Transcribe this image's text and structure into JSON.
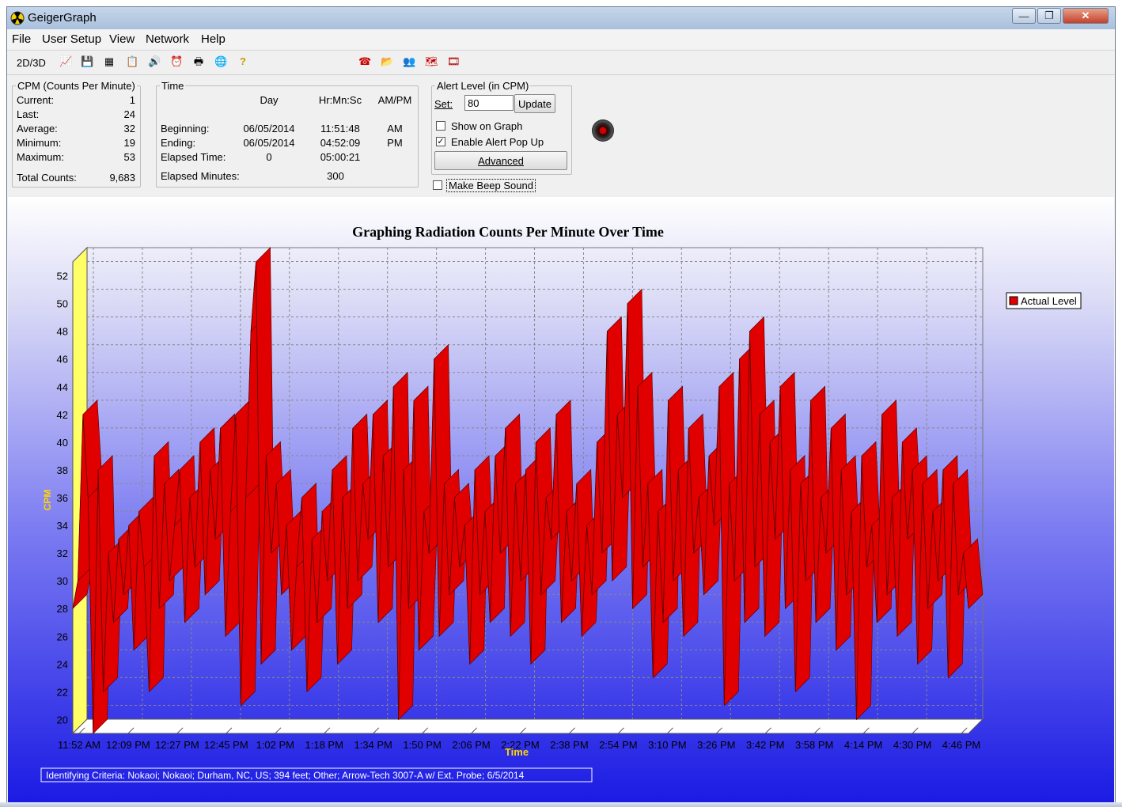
{
  "window": {
    "title": "GeigerGraph",
    "minimize": "—",
    "maximize": "❐",
    "close": "✕"
  },
  "menu": [
    "File",
    "User Setup",
    "View",
    "Network",
    "Help"
  ],
  "toolbar": {
    "mode_label": "2D/3D",
    "icons": [
      "graph-settings-icon",
      "save-icon",
      "table-icon",
      "report-icon",
      "alarm-icon",
      "clock-icon",
      "print-icon",
      "globe-icon",
      "help-icon",
      "phone-icon",
      "export-icon",
      "users-icon",
      "map-icon",
      "film-icon"
    ]
  },
  "cpm": {
    "legend": "CPM (Counts Per Minute)",
    "rows": [
      {
        "label": "Current:",
        "value": "1"
      },
      {
        "label": "Last:",
        "value": "24"
      },
      {
        "label": "Average:",
        "value": "32"
      },
      {
        "label": "Minimum:",
        "value": "19"
      },
      {
        "label": "Maximum:",
        "value": "53"
      }
    ],
    "total_label": "Total Counts:",
    "total_value": "9,683"
  },
  "time": {
    "legend": "Time",
    "headers": [
      "Day",
      "Hr:Mn:Sc",
      "AM/PM"
    ],
    "beginning": {
      "label": "Beginning:",
      "day": "06/05/2014",
      "hms": "11:51:48",
      "ampm": "AM"
    },
    "ending": {
      "label": "Ending:",
      "day": "06/05/2014",
      "hms": "04:52:09",
      "ampm": "PM"
    },
    "elapsed_time": {
      "label": "Elapsed Time:",
      "day": "0",
      "hms": "05:00:21"
    },
    "elapsed_minutes": {
      "label": "Elapsed Minutes:",
      "value": "300"
    }
  },
  "alert": {
    "legend": "Alert Level (in CPM)",
    "set_label": "Set:",
    "set_value": "80",
    "update_label": "Update",
    "show_on_graph": {
      "label": "Show on Graph",
      "checked": false
    },
    "enable_popup": {
      "label": "Enable Alert Pop Up",
      "checked": true
    },
    "advanced_label": "Advanced",
    "beep": {
      "label": "Make Beep Sound",
      "checked": false
    }
  },
  "chart_data": {
    "type": "area",
    "title": "Graphing Radiation Counts Per Minute Over Time",
    "xlabel": "Time",
    "ylabel": "CPM",
    "ylim": [
      19,
      53
    ],
    "yticks": [
      20,
      22,
      24,
      26,
      28,
      30,
      32,
      34,
      36,
      38,
      40,
      42,
      44,
      46,
      48,
      50,
      52
    ],
    "xticks": [
      "11:52 AM",
      "12:09 PM",
      "12:27 PM",
      "12:45 PM",
      "1:02 PM",
      "1:18 PM",
      "1:34 PM",
      "1:50 PM",
      "2:06 PM",
      "2:22 PM",
      "2:38 PM",
      "2:54 PM",
      "3:10 PM",
      "3:26 PM",
      "3:42 PM",
      "3:58 PM",
      "4:14 PM",
      "4:30 PM",
      "4:46 PM"
    ],
    "legend": "top-right",
    "grid": true,
    "series": [
      {
        "name": "Actual Level",
        "color": "#e10000",
        "values": [
          28,
          30,
          42,
          36,
          19,
          38,
          22,
          32,
          27,
          33,
          29,
          34,
          25,
          35,
          31,
          22,
          39,
          28,
          37,
          30,
          34,
          38,
          27,
          36,
          31,
          40,
          29,
          38,
          33,
          41,
          26,
          35,
          42,
          21,
          36,
          48,
          53,
          24,
          39,
          32,
          37,
          29,
          34,
          25,
          31,
          36,
          22,
          33,
          27,
          35,
          30,
          38,
          24,
          36,
          28,
          41,
          30,
          37,
          33,
          42,
          27,
          39,
          31,
          44,
          20,
          38,
          28,
          43,
          25,
          35,
          32,
          46,
          26,
          37,
          29,
          36,
          31,
          34,
          24,
          38,
          29,
          35,
          27,
          39,
          32,
          41,
          26,
          37,
          30,
          38,
          24,
          40,
          29,
          36,
          33,
          42,
          27,
          35,
          30,
          37,
          26,
          34,
          29,
          40,
          32,
          48,
          30,
          42,
          36,
          50,
          28,
          44,
          31,
          37,
          23,
          35,
          27,
          43,
          30,
          38,
          26,
          41,
          32,
          36,
          29,
          39,
          34,
          44,
          21,
          37,
          30,
          46,
          27,
          48,
          31,
          42,
          26,
          40,
          33,
          44,
          28,
          38,
          22,
          37,
          30,
          43,
          27,
          36,
          32,
          41,
          25,
          38,
          29,
          35,
          20,
          39,
          31,
          34,
          27,
          42,
          29,
          36,
          26,
          40,
          33,
          38,
          24,
          37,
          28,
          35,
          30,
          38,
          23,
          37,
          29,
          32,
          28
        ]
      }
    ]
  },
  "criteria": "Identifying Criteria:  Nokaoi;  Nokaoi;  Durham, NC, US;  394 feet;  Other;  Arrow-Tech 3007-A w/ Ext. Probe;  6/5/2014"
}
